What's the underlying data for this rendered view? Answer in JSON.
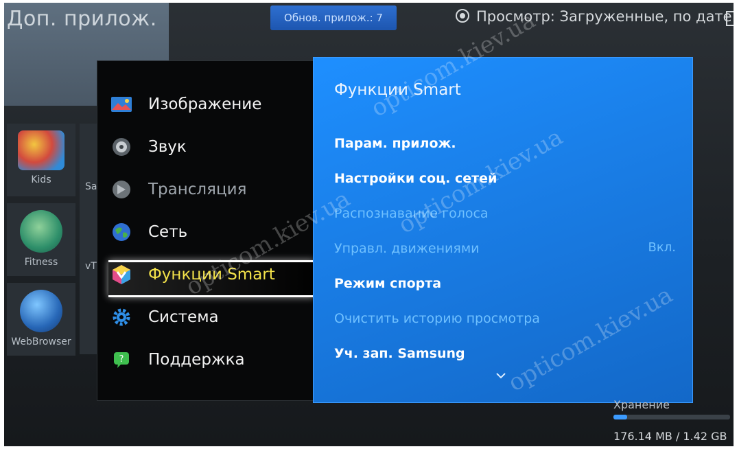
{
  "header": {
    "app_title": "Доп. прилож.",
    "update_button": "Обнов. прилож.: 7",
    "view_option": "Просмотр: Загруженные, по дате"
  },
  "apps": [
    {
      "label": "Kids",
      "icon": "kids-app-icon"
    },
    {
      "label": "Fitness",
      "icon": "fitness-app-icon"
    },
    {
      "label": "WebBrowser",
      "icon": "webbrowser-app-icon"
    }
  ],
  "apps_partial": [
    "Sa",
    "vT"
  ],
  "menu": {
    "items": [
      {
        "label": "Изображение",
        "icon": "picture-icon"
      },
      {
        "label": "Звук",
        "icon": "speaker-icon"
      },
      {
        "label": "Трансляция",
        "icon": "broadcast-icon"
      },
      {
        "label": "Сеть",
        "icon": "globe-icon"
      },
      {
        "label": "Функции Smart",
        "icon": "smart-hub-icon"
      },
      {
        "label": "Система",
        "icon": "gear-icon"
      },
      {
        "label": "Поддержка",
        "icon": "support-icon"
      }
    ],
    "active_index": 4
  },
  "submenu": {
    "title": "Функции Smart",
    "items": [
      {
        "label": "Парам. прилож.",
        "enabled": true
      },
      {
        "label": "Настройки соц. сетей",
        "enabled": true
      },
      {
        "label": "Распознавание голоса",
        "enabled": false
      },
      {
        "label": "Управл. движениями",
        "enabled": false,
        "value": "Вкл."
      },
      {
        "label": "Режим спорта",
        "enabled": true
      },
      {
        "label": "Очистить историю просмотра",
        "enabled": false
      },
      {
        "label": "Уч. зап. Samsung",
        "enabled": true
      }
    ],
    "more_icon": "chevron-down-icon"
  },
  "storage": {
    "label": "Хранение",
    "value": "176.14 MB / 1.42 GB",
    "used_fraction": 0.12
  },
  "watermarks": [
    "opticom.kiev.ua",
    "opticom.kiev.ua",
    "opticom.kiev.ua",
    "opticom.kiev.ua"
  ]
}
